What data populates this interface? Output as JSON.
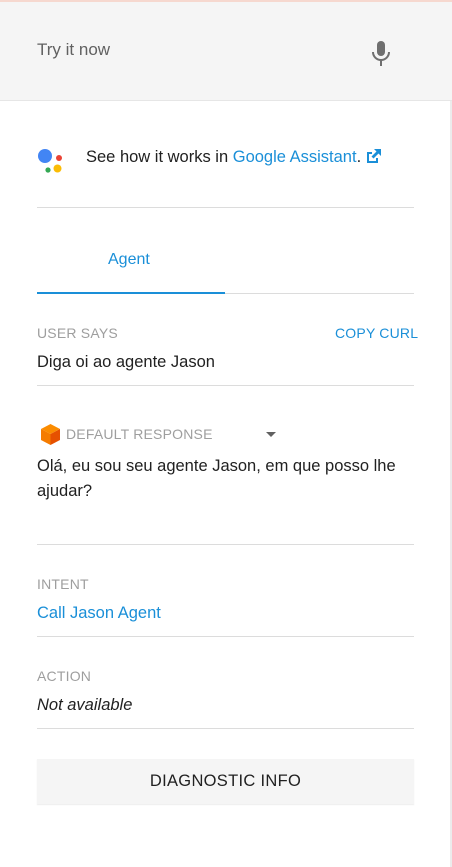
{
  "try_it": {
    "placeholder": "Try it now",
    "mic_icon": "microphone-icon"
  },
  "assistant": {
    "prefix": "See how it works in ",
    "link_text": "Google Assistant",
    "suffix": ".",
    "logo_icon": "google-assistant-logo",
    "external_icon": "external-link-icon"
  },
  "tabs": [
    {
      "label": "Agent",
      "active": true
    }
  ],
  "user_says": {
    "label": "USER SAYS",
    "copy_label": "COPY CURL",
    "value": "Diga oi ao agente Jason"
  },
  "default_response": {
    "label": "DEFAULT RESPONSE",
    "icon": "response-cube-icon",
    "text": "Olá, eu sou seu agente Jason, em que posso lhe ajudar?"
  },
  "intent": {
    "label": "INTENT",
    "value": "Call Jason Agent"
  },
  "action": {
    "label": "ACTION",
    "value": "Not available"
  },
  "diagnostic": {
    "label": "DIAGNOSTIC INFO"
  },
  "colors": {
    "accent": "#1a8fd8",
    "label_gray": "#9e9e9e",
    "bar_bg": "#f5f5f5",
    "cube_orange": "#f57c00"
  }
}
